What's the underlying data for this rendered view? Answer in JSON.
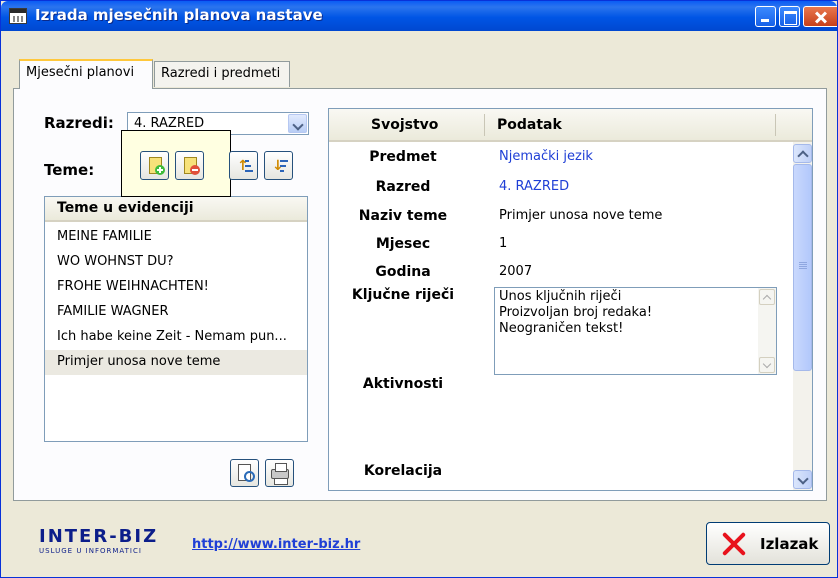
{
  "window": {
    "title": "Izrada mjesečnih planova nastave"
  },
  "tabs": [
    {
      "label": "Mjesečni planovi"
    },
    {
      "label": "Razredi i predmeti"
    }
  ],
  "left": {
    "razredi_label": "Razredi:",
    "razredi_value": "4. RAZRED",
    "teme_label": "Teme:",
    "tool_icons": [
      "add-document-icon",
      "remove-document-icon",
      "sort-ascending-icon",
      "sort-descending-icon"
    ],
    "list_header": "Teme u evidenciji",
    "list_items": [
      "MEINE FAMILIE",
      "WO WOHNST DU?",
      "FROHE WEIHNACHTEN!",
      "FAMILIE WAGNER",
      "Ich habe keine Zeit - Nemam pun...",
      "Primjer unosa nove teme"
    ],
    "bottom_icons": [
      "print-preview-icon",
      "printer-icon"
    ]
  },
  "grid": {
    "col_property": "Svojstvo",
    "col_value": "Podatak",
    "rows": [
      {
        "property": "Predmet",
        "value": "Njemački jezik"
      },
      {
        "property": "Razred",
        "value": "4. RAZRED"
      },
      {
        "property": "Naziv teme",
        "value": "Primjer unosa nove teme"
      },
      {
        "property": "Mjesec",
        "value": "1"
      },
      {
        "property": "Godina",
        "value": "2007"
      },
      {
        "property": "Ključne riječi",
        "lines": [
          "Unos ključnih riječi",
          "Proizvoljan broj redaka!",
          "Neograničen tekst!"
        ]
      },
      {
        "property": "Aktivnosti",
        "value": ""
      },
      {
        "property": "Korelacija",
        "value": ""
      }
    ]
  },
  "footer": {
    "brand_name": "INTER-BIZ",
    "brand_tagline": "USLUGE U INFORMATICI",
    "url": "http://www.inter-biz.hr",
    "exit_label": "Izlazak"
  },
  "colors": {
    "title_bar": "#0055e5",
    "link": "#1f3fd6",
    "brand": "#0c1e8a",
    "exit_icon": "#e8121c",
    "tooltip_bg": "#ffffe1"
  }
}
